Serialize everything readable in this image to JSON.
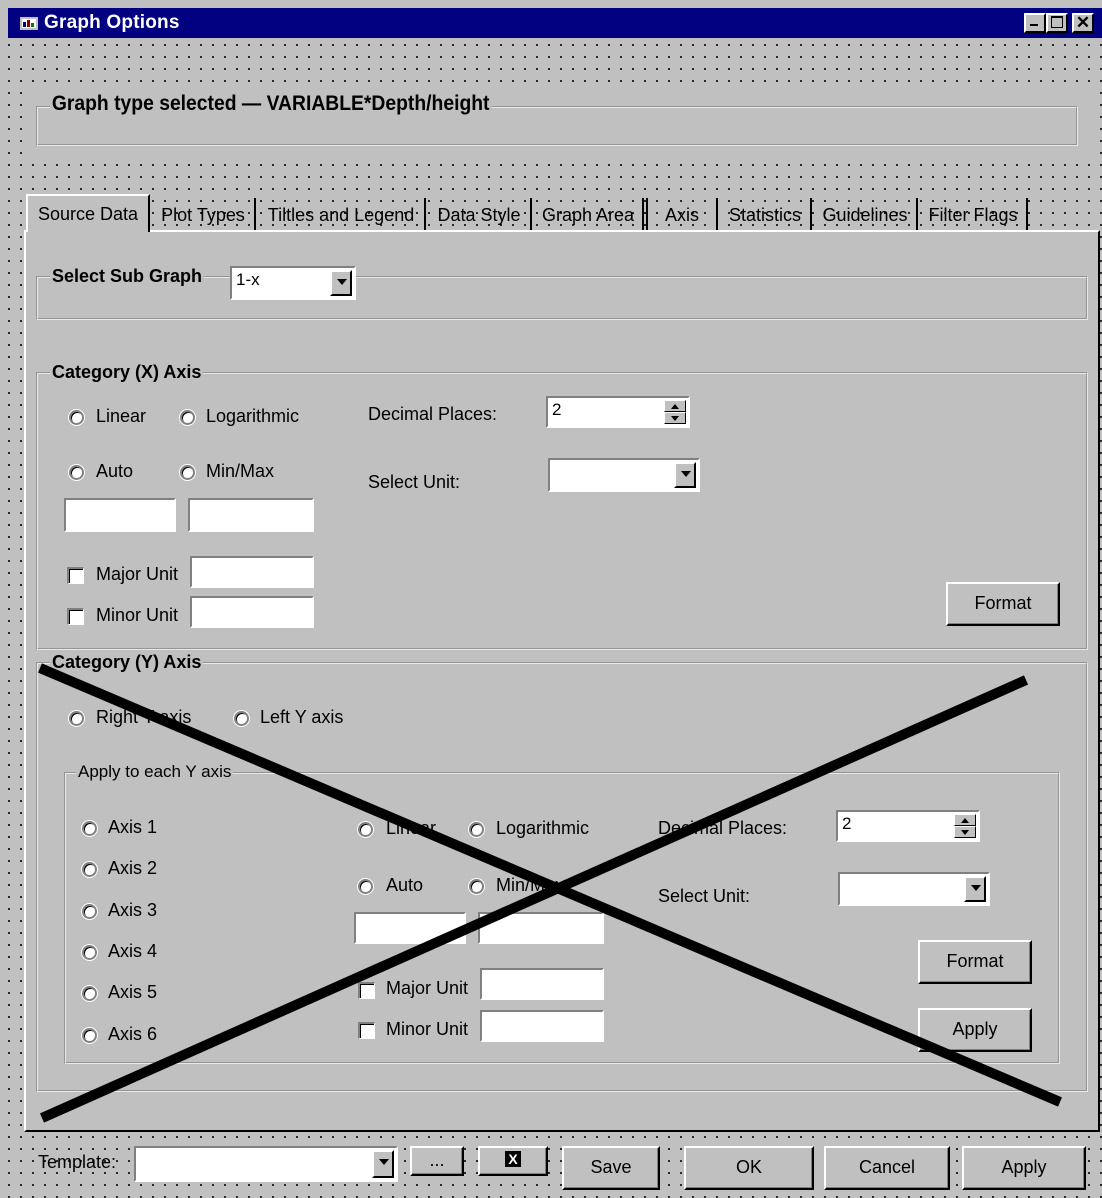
{
  "window": {
    "title": "Graph Options"
  },
  "header": {
    "label": "Graph type selected",
    "value": "VARIABLE*Depth/height"
  },
  "tabs": [
    "Source Data",
    "Plot Types",
    "Tiltles and Legend",
    "Data Style",
    "Graph Area",
    "Axis",
    "Statistics",
    "Guidelines",
    "Filter Flags"
  ],
  "subgraph": {
    "label": "Select Sub Graph",
    "value": "1-x"
  },
  "x_axis": {
    "title": "Category (X) Axis",
    "linear": "Linear",
    "log": "Logarithmic",
    "auto": "Auto",
    "minmax": "Min/Max",
    "decimal_label": "Decimal Places:",
    "decimal_value": "2",
    "unit_label": "Select Unit:",
    "unit_value": "",
    "major": "Major Unit",
    "minor": "Minor Unit",
    "format": "Format"
  },
  "y_axis": {
    "title": "Category (Y) Axis",
    "right": "Right Y axis",
    "left": "Left Y axis",
    "apply_group": "Apply to each Y axis",
    "axes": [
      "Axis 1",
      "Axis 2",
      "Axis 3",
      "Axis 4",
      "Axis 5",
      "Axis 6"
    ],
    "linear": "Linear",
    "log": "Logarithmic",
    "auto": "Auto",
    "minmax": "Min/Max",
    "decimal_label": "Decimal Places:",
    "decimal_value": "2",
    "unit_label": "Select Unit:",
    "unit_value": "",
    "major": "Major Unit",
    "minor": "Minor Unit",
    "format": "Format",
    "apply": "Apply"
  },
  "footer": {
    "template_label": "Template:",
    "template_value": "",
    "browse": "...",
    "clear": "X",
    "save": "Save",
    "ok": "OK",
    "cancel": "Cancel",
    "apply": "Apply"
  }
}
